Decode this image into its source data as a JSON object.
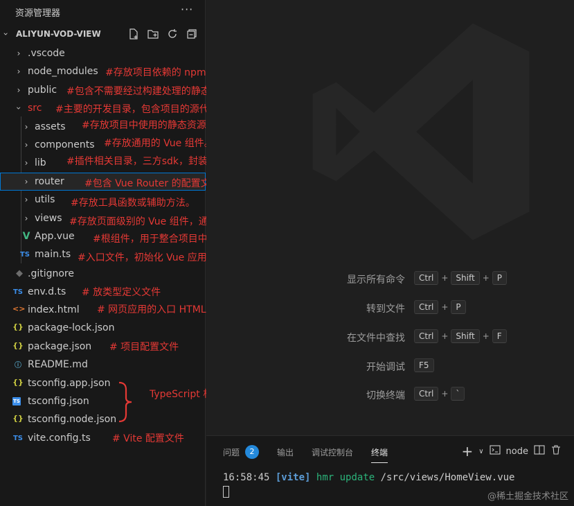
{
  "explorer": {
    "title": "资源管理器",
    "more": "···",
    "project_name": "ALIYUN-VOD-VIEW",
    "items": [
      {
        "label": ".vscode",
        "note": ""
      },
      {
        "label": "node_modules",
        "note": "#存放项目依赖的 npm 包。"
      },
      {
        "label": "public",
        "note": "#包含不需要经过构建处理的静态资源文件，如 index.html 文件和一些直接访问的静态资源。"
      },
      {
        "label": "src",
        "note": "#主要的开发目录，包含项目的源代码。"
      },
      {
        "label": "assets",
        "note": "#存放项目中使用的静态资源，如图片、样式文件等。"
      },
      {
        "label": "components",
        "note": "#存放通用的 Vue 组件。"
      },
      {
        "label": "lib",
        "note": "#插件相关目录，三方sdk，封装的方法等"
      },
      {
        "label": "router",
        "note": "#包含 Vue Router 的配置文件。"
      },
      {
        "label": "utils",
        "note": "#存放工具函数或辅助方法。"
      },
      {
        "label": "views",
        "note": "#存放页面级别的 Vue 组件，通常与路由对应。"
      },
      {
        "label": "App.vue",
        "note": "#根组件，用于整合项目中的其他组件。",
        "icon": "V"
      },
      {
        "label": "main.ts",
        "note": "#入口文件，初始化 Vue 应用并加载所需的插件等。",
        "icon": "TS"
      },
      {
        "label": ".gitignore",
        "note": ""
      },
      {
        "label": "env.d.ts",
        "note": "# 放类型定义文件",
        "icon": "TS"
      },
      {
        "label": "index.html",
        "note": "# 网页应用的入口 HTML 文件",
        "icon": "<>"
      },
      {
        "label": "package-lock.json",
        "note": "",
        "icon": "{}"
      },
      {
        "label": "package.json",
        "note": "# 项目配置文件",
        "icon": "{}"
      },
      {
        "label": "README.md",
        "note": "",
        "icon": "i"
      },
      {
        "label": "tsconfig.app.json",
        "note": "",
        "icon": "{}"
      },
      {
        "label": "tsconfig.json",
        "note": "",
        "icon": "TS"
      },
      {
        "label": "tsconfig.node.json",
        "note": "",
        "icon": "{}"
      },
      {
        "label": "vite.config.ts",
        "note": "# Vite 配置文件",
        "icon": "TS"
      }
    ],
    "ts_note": "TypeScript 相关的"
  },
  "editor": {
    "commands": [
      {
        "label": "显示所有命令",
        "keys": [
          "Ctrl",
          "Shift",
          "P"
        ]
      },
      {
        "label": "转到文件",
        "keys": [
          "Ctrl",
          "P"
        ]
      },
      {
        "label": "在文件中查找",
        "keys": [
          "Ctrl",
          "Shift",
          "F"
        ]
      },
      {
        "label": "开始调试",
        "keys": [
          "F5"
        ]
      },
      {
        "label": "切换终端",
        "keys": [
          "Ctrl",
          "`"
        ]
      }
    ],
    "plus": "+"
  },
  "panel": {
    "tabs": {
      "problems": "问题",
      "problems_count": "2",
      "output": "输出",
      "debug_console": "调试控制台",
      "terminal": "终端"
    },
    "terminal_name": "node",
    "terminal_line": {
      "time": "16:58:45",
      "vite": "[vite]",
      "hmr": "hmr update",
      "path": "/src/views/HomeView.vue"
    }
  },
  "watermark": "@稀土掘金技术社区",
  "colors": {
    "annotation": "#e53935",
    "accent": "#0078d4",
    "badge": "#2489db"
  }
}
